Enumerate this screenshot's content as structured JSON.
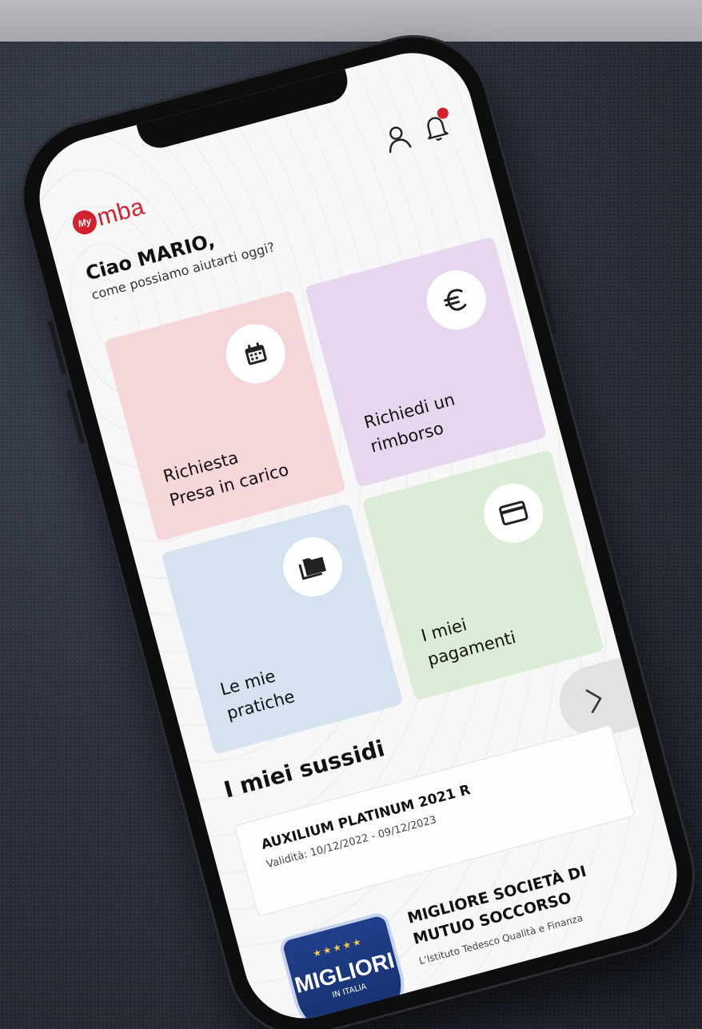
{
  "app": {
    "logo_badge": "My",
    "logo_text": "mba",
    "brand_color": "#d3202f"
  },
  "header": {
    "icons": [
      "user-icon",
      "bell-icon"
    ],
    "has_notification": true
  },
  "greeting": {
    "title": "Ciao MARIO,",
    "subtitle": "come possiamo aiutarti oggi?"
  },
  "tiles": [
    {
      "label": "Richiesta\nPresa in carico",
      "icon": "calendar-icon",
      "color": "#f5d7da"
    },
    {
      "label": "Richiedi un\nrimborso",
      "icon": "euro-icon",
      "color": "#e6d7ee"
    },
    {
      "label": "Le mie\npratiche",
      "icon": "folder-icon",
      "color": "#d5e2ef"
    },
    {
      "label": "I miei\npagamenti",
      "icon": "credit-card-icon",
      "color": "#dcecd6"
    }
  ],
  "subsidies": {
    "title": "I miei sussidi",
    "next_icon": "chevron-right-icon",
    "card": {
      "name": "AUXILIUM PLATINUM 2021 R",
      "validity": "Validità: 10/12/2022 - 09/12/2023"
    }
  },
  "award": {
    "badge_word": "MIGLIORI",
    "badge_sub": "IN ITALIA",
    "badge_stars": "★★★★★",
    "title": "MIGLIORE SOCIETÀ DI\nMUTUO SOCCORSO",
    "description": "L'Istituto Tedesco Qualità e Finanza"
  }
}
